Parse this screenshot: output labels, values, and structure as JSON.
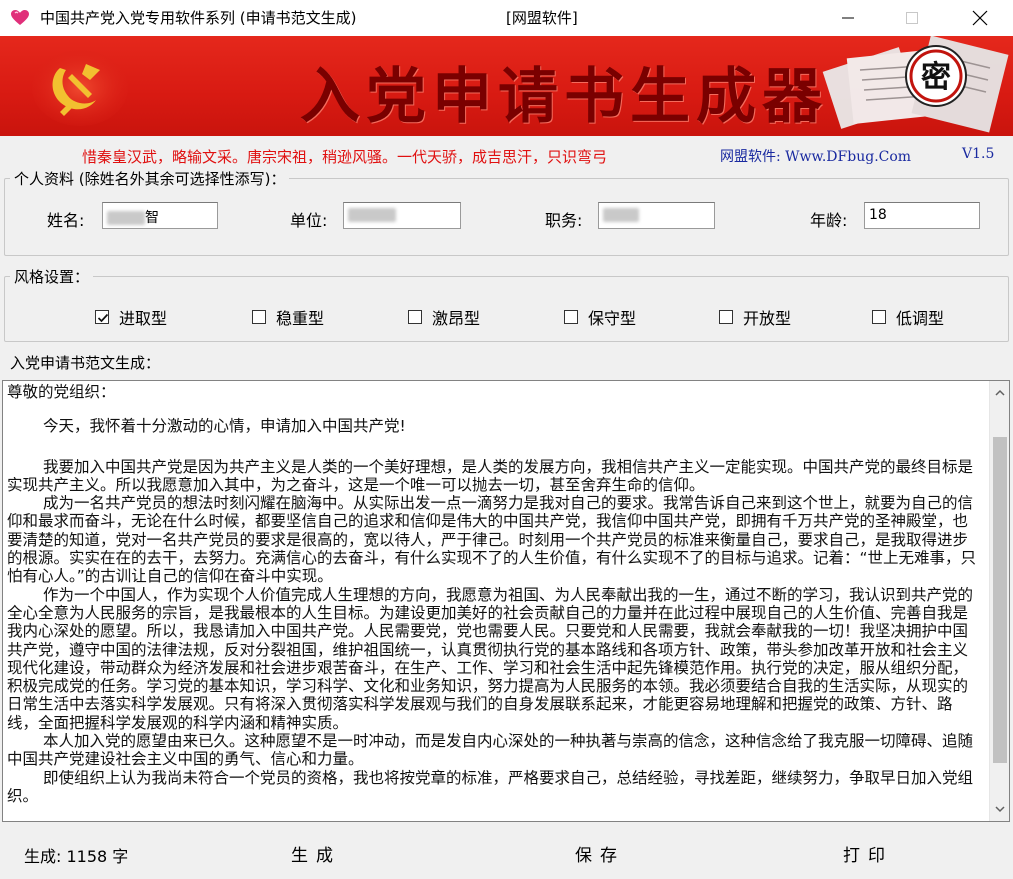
{
  "window": {
    "title": "中国共产党入党专用软件系列 (申请书范文生成)",
    "title_vendor": "[网盟软件]",
    "icons": [
      "heart-icon",
      "minimize-icon",
      "maximize-icon",
      "close-icon"
    ]
  },
  "banner": {
    "title": "入党申请书生成器",
    "seal_text": "密",
    "colors": {
      "background": "#d81a12",
      "title": "#7a0000",
      "seal": "#c2140e"
    }
  },
  "marquee": {
    "slogan": "惜秦皇汉武，略输文采。唐宗宋祖，稍逊风骚。一代天骄，成吉思汗，只识弯弓",
    "site": "网盟软件: Www.DFbug.Com",
    "version": "V1.5",
    "colors": {
      "slogan": "#e01010",
      "site": "#1a2aa0"
    }
  },
  "personal": {
    "group_label": "个人资料 (除姓名外其余可选择性添写)：",
    "name_label": "姓名:",
    "name_value": "智",
    "unit_label": "单位:",
    "unit_value": "",
    "position_label": "职务:",
    "position_value": "",
    "age_label": "年龄:",
    "age_value": "18"
  },
  "style": {
    "group_label": "风格设置：",
    "options": [
      {
        "label": "进取型",
        "checked": true
      },
      {
        "label": "稳重型",
        "checked": false
      },
      {
        "label": "激昂型",
        "checked": false
      },
      {
        "label": "保守型",
        "checked": false
      },
      {
        "label": "开放型",
        "checked": false
      },
      {
        "label": "低调型",
        "checked": false
      }
    ]
  },
  "essay": {
    "group_label": "入党申请书范文生成：",
    "greeting": "尊敬的党组织：",
    "opening": "今天，我怀着十分激动的心情，申请加入中国共产党!",
    "paragraphs": [
      "我要加入中国共产党是因为共产主义是人类的一个美好理想，是人类的发展方向，我相信共产主义一定能实现。中国共产党的最终目标是实现共产主义。所以我愿意加入其中，为之奋斗，这是一个唯一可以抛去一切，甚至舍弃生命的信仰。",
      "成为一名共产党员的想法时刻闪耀在脑海中。从实际出发一点一滴努力是我对自己的要求。我常告诉自己来到这个世上，就要为自己的信仰和最求而奋斗，无论在什么时候，都要坚信自己的追求和信仰是伟大的中国共产党，我信仰中国共产党，即拥有千万共产党的圣神殿堂，也要清楚的知道，党对一名共产党员的要求是很高的，宽以待人，严于律己。时刻用一个共产党员的标准来衡量自己，要求自己，是我取得进步的根源。实实在在的去干，去努力。充满信心的去奋斗，有什么实现不了的人生价值，有什么实现不了的目标与追求。记着：“世上无难事，只怕有心人。”的古训让自己的信仰在奋斗中实现。",
      "作为一个中国人，作为实现个人价值完成人生理想的方向，我愿意为祖国、为人民奉献出我的一生，通过不断的学习，我认识到共产党的全心全意为人民服务的宗旨，是我最根本的人生目标。为建设更加美好的社会贡献自己的力量并在此过程中展现自己的人生价值、完善自我是我内心深处的愿望。所以，我恳请加入中国共产党。人民需要党，党也需要人民。只要党和人民需要，我就会奉献我的一切！我坚决拥护中国共产党，遵守中国的法律法规，反对分裂祖国，维护祖国统一，认真贯彻执行党的基本路线和各项方针、政策，带头参加改革开放和社会主义现代化建设，带动群众为经济发展和社会进步艰苦奋斗，在生产、工作、学习和社会生活中起先锋模范作用。执行党的决定，服从组织分配，积极完成党的任务。学习党的基本知识，学习科学、文化和业务知识，努力提高为人民服务的本领。我必须要结合自我的生活实际，从现实的日常生活中去落实科学发展观。只有将深入贯彻落实科学发展观与我们的自身发展联系起来，才能更容易地理解和把握党的政策、方针、路线，全面把握科学发展观的科学内涵和精神实质。",
      "本人加入党的愿望由来已久。这种愿望不是一时冲动，而是发自内心深处的一种执著与崇高的信念，这种信念给了我克服一切障碍、追随中国共产党建设社会主义中国的勇气、信心和力量。",
      "即使组织上认为我尚未符合一个党员的资格，我也将按党章的标准，严格要求自己，总结经验，寻找差距，继续努力，争取早日加入党组织。"
    ]
  },
  "footer": {
    "count_label": "生成: 1158 字",
    "generate_label": "生成",
    "save_label": "保存",
    "print_label": "打印"
  }
}
